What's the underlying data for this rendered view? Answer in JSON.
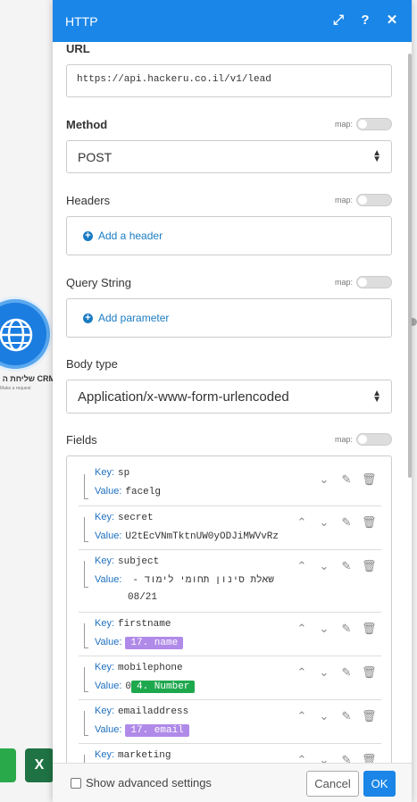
{
  "canvas": {
    "node_title": "שליחת ה CRM",
    "node_subtitle": "Make a request",
    "excel_label": "X"
  },
  "panel": {
    "title": "HTTP",
    "header_icons": [
      "expand-icon",
      "help-icon",
      "close-icon"
    ]
  },
  "url": {
    "label": "URL",
    "value": "https://api.hackeru.co.il/v1/lead"
  },
  "method": {
    "label": "Method",
    "map_label": "map:",
    "value": "POST"
  },
  "headers": {
    "label": "Headers",
    "map_label": "map:",
    "add_label": "Add a header"
  },
  "query": {
    "label": "Query String",
    "map_label": "map:",
    "add_label": "Add parameter"
  },
  "body_type": {
    "label": "Body type",
    "value": "Application/x-www-form-urlencoded"
  },
  "fields": {
    "label": "Fields",
    "map_label": "map:",
    "key_label": "Key:",
    "value_label": "Value:",
    "items": [
      {
        "key": "sp",
        "value": "facelg"
      },
      {
        "key": "secret",
        "value": "U2tEcVNmTktnUW0yODJiMWVvRz"
      },
      {
        "key": "subject",
        "value_line1": "שאלת סינון תחומי לימוד -",
        "value_line2": "08/21"
      },
      {
        "key": "firstname",
        "pill": "17. name"
      },
      {
        "key": "mobilephone",
        "prefix": "0",
        "pill": "4. Number"
      },
      {
        "key": "emailaddress",
        "pill": "17. email"
      },
      {
        "key": "marketing"
      }
    ]
  },
  "footer": {
    "advanced_label": "Show advanced settings",
    "cancel_label": "Cancel",
    "ok_label": "OK"
  }
}
